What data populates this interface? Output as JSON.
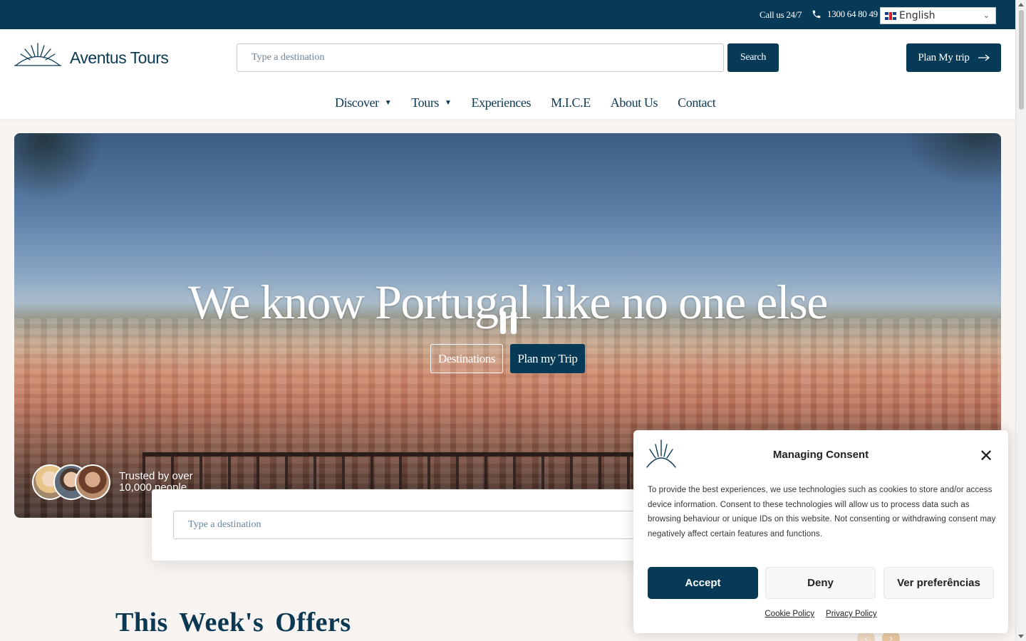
{
  "topbar": {
    "call_label": "Call us 24/7",
    "phone": "1300 64 80 49",
    "language": "English",
    "icons": {
      "phone": "phone-icon",
      "flag": "uk-flag-icon",
      "chevron": "chevron-down-icon"
    }
  },
  "header": {
    "brand_name": "Aventus Tours",
    "search_placeholder": "Type a destination",
    "search_button": "Search",
    "plan_button": "Plan My trip",
    "nav": [
      {
        "label": "Discover",
        "has_dropdown": true
      },
      {
        "label": "Tours",
        "has_dropdown": true
      },
      {
        "label": "Experiences",
        "has_dropdown": false
      },
      {
        "label": "M.I.C.E",
        "has_dropdown": false
      },
      {
        "label": "About Us",
        "has_dropdown": false
      },
      {
        "label": "Contact",
        "has_dropdown": false
      }
    ]
  },
  "hero": {
    "headline": "We know Portugal like no one else",
    "destinations_button": "Destinations",
    "plan_trip_button": "Plan my Trip",
    "trusted_text": "Trusted by over 10,000 people"
  },
  "search_card": {
    "placeholder": "Type a destination"
  },
  "offers": {
    "title": "This Week's Offers"
  },
  "consent": {
    "title": "Managing Consent",
    "body": "To provide the best experiences, we use technologies such as cookies to store and/or access device information. Consent to these technologies will allow us to process data such as browsing behaviour or unique IDs on this website. Not consenting or withdrawing consent may negatively affect certain features and functions.",
    "accept": "Accept",
    "deny": "Deny",
    "preferences": "Ver preferências",
    "cookie_policy": "Cookie Policy",
    "privacy_policy": "Privacy Policy"
  },
  "colors": {
    "brand": "#063a56",
    "accent_arrow": "#e9c9a4",
    "page_bg": "#f8f4f1"
  }
}
